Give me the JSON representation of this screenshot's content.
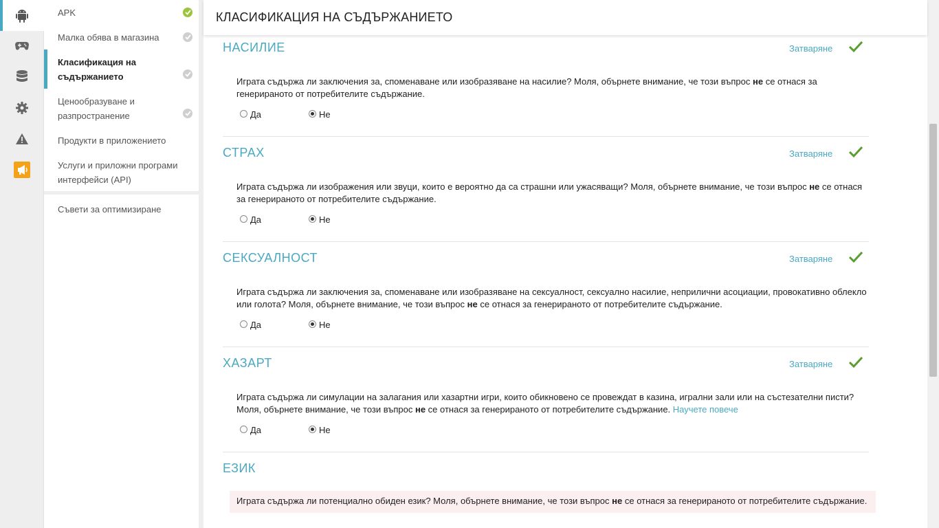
{
  "header": {
    "title": "КЛАСИФИКАЦИЯ НА СЪДЪРЖАНИЕТО"
  },
  "rail": {
    "items": [
      {
        "icon": "android-icon",
        "active": true
      },
      {
        "icon": "gamepad-icon"
      },
      {
        "icon": "database-icon"
      },
      {
        "icon": "gear-icon"
      },
      {
        "icon": "warning-icon"
      },
      {
        "icon": "megaphone-icon"
      }
    ]
  },
  "sidebar": {
    "items": [
      {
        "label": "APK",
        "status": "done"
      },
      {
        "label": "Малка обява в магазина",
        "status": "pending"
      },
      {
        "label": "Класификация на съдържанието",
        "status": "pending",
        "active": true
      },
      {
        "label": "Ценообразуване и разпространение",
        "status": "pending"
      },
      {
        "label": "Продукти в приложението"
      },
      {
        "label": "Услуги и приложни програми интерфейси (API)"
      }
    ],
    "tips": "Съвети за оптимизиране"
  },
  "close_label": "Затваряне",
  "yes_label": "Да",
  "no_label": "Не",
  "learn_more": "Научете повече",
  "sections": [
    {
      "title": "НАСИЛИЕ",
      "q_before": "Играта съдържа ли заключения за, споменаване или изобразяване на насилие? Моля, обърнете внимание, че този въпрос ",
      "q_bold": "не",
      "q_after": " се отнася за генерираното от потребителите съдържание.",
      "answer": "no"
    },
    {
      "title": "СТРАХ",
      "q_before": "Играта съдържа ли изображения или звуци, които е вероятно да са страшни или ужасяващи? Моля, обърнете внимание, че този въпрос ",
      "q_bold": "не",
      "q_after": " се отнася за генерираното от потребителите съдържание.",
      "answer": "no"
    },
    {
      "title": "СЕКСУАЛНОСТ",
      "q_before": "Играта съдържа ли заключения за, споменаване или изобразяване на сексуалност, сексуално насилие, неприлични асоциации, провокативно облекло или голота? Моля, обърнете внимание, че този въпрос ",
      "q_bold": "не",
      "q_after": " се отнася за генерираното от потребителите съдържание.",
      "answer": "no"
    },
    {
      "title": "ХАЗАРТ",
      "q_before": "Играта съдържа ли симулации на залагания или хазартни игри, които обикновено се провеждат в казина, игрални зали или на състезателни писти? Моля, обърнете внимание, че този въпрос ",
      "q_bold": "не",
      "q_after": " се отнася за генерираното от потребителите съдържание. ",
      "answer": "no"
    }
  ],
  "language_section": {
    "title": "ЕЗИК",
    "q_before": "Играта съдържа ли потенциално обиден език? Моля, обърнете внимание, че този въпрос ",
    "q_bold": "не",
    "q_after": " се отнася за генерираното от потребителите съдържание."
  },
  "colors": {
    "accent": "#4aa9c2",
    "check": "#5a9e2f",
    "done": "#9cc43c",
    "warning_bg": "#fcefef"
  }
}
